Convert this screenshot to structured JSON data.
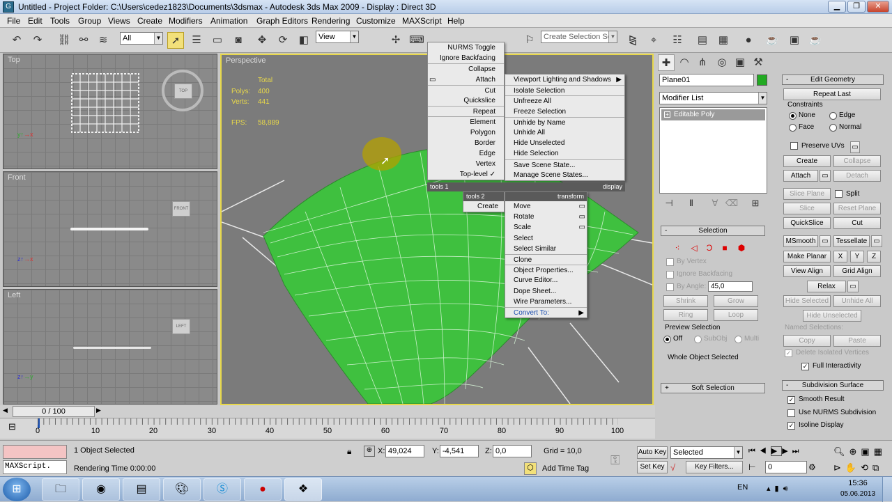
{
  "window": {
    "title": "Untitled     - Project Folder: C:\\Users\\cedez1823\\Documents\\3dsmax     - Autodesk 3ds Max 2009     - Display : Direct 3D",
    "icon": "3dsmax-app-icon"
  },
  "menu": [
    "File",
    "Edit",
    "Tools",
    "Group",
    "Views",
    "Create",
    "Modifiers",
    "Animation",
    "Graph Editors",
    "Rendering",
    "Customize",
    "MAXScript",
    "Help"
  ],
  "toolbar": {
    "selection_filter": "All",
    "reference_coord": "View",
    "named_selection_placeholder": "Create Selection Set",
    "snap_labels": [
      "3",
      "∆",
      "%"
    ]
  },
  "viewports": {
    "top": {
      "label": "Top",
      "cube": "TOP"
    },
    "front": {
      "label": "Front",
      "cube": "FRONT"
    },
    "left": {
      "label": "Left",
      "cube": "LEFT"
    },
    "perspective": {
      "label": "Perspective",
      "stats_header": "Total",
      "polys_label": "Polys:",
      "polys_value": "400",
      "verts_label": "Verts:",
      "verts_value": "441",
      "fps_label": "FPS:",
      "fps_value": "58,889"
    }
  },
  "quad_menu": {
    "tools1": {
      "items": [
        "NURMS Toggle",
        "Ignore Backfacing",
        "Collapse",
        "Attach",
        "Cut",
        "Quickslice",
        "Repeat",
        "Element",
        "Polygon",
        "Border",
        "Edge",
        "Vertex",
        "Top-level"
      ],
      "checked": "Top-level",
      "header_left": "tools 1",
      "header_right": "display"
    },
    "tools2": {
      "header": "tools 2",
      "items": [
        "Create"
      ]
    },
    "display": {
      "items": [
        "Viewport Lighting and Shadows",
        "Isolate Selection",
        "Unfreeze All",
        "Freeze Selection",
        "Unhide by Name",
        "Unhide All",
        "Hide Unselected",
        "Hide Selection",
        "Save Scene State...",
        "Manage Scene States..."
      ]
    },
    "transform": {
      "header": "transform",
      "items": [
        "Move",
        "Rotate",
        "Scale",
        "Select",
        "Select Similar",
        "Clone",
        "Object Properties...",
        "Curve Editor...",
        "Dope Sheet...",
        "Wire Parameters...",
        "Convert To:"
      ]
    }
  },
  "command_panel": {
    "object_name": "Plane01",
    "object_color": "#22aa22",
    "modifier_list": "Modifier List",
    "stack_item": "Editable Poly",
    "selection": {
      "header": "Selection",
      "by_vertex": "By Vertex",
      "ignore_backfacing": "Ignore Backfacing",
      "by_angle": "By Angle:",
      "angle_value": "45,0",
      "shrink": "Shrink",
      "grow": "Grow",
      "ring": "Ring",
      "loop": "Loop",
      "preview_header": "Preview Selection",
      "preview_off": "Off",
      "preview_subobj": "SubObj",
      "preview_multi": "Multi",
      "whole_object": "Whole Object Selected"
    },
    "soft_selection": "Soft Selection",
    "edit_geometry": {
      "header": "Edit Geometry",
      "repeat_last": "Repeat Last",
      "constraints": "Constraints",
      "none": "None",
      "edge": "Edge",
      "face": "Face",
      "normal": "Normal",
      "preserve_uvs": "Preserve UVs",
      "create": "Create",
      "collapse": "Collapse",
      "attach": "Attach",
      "detach": "Detach",
      "slice_plane": "Slice Plane",
      "split": "Split",
      "slice": "Slice",
      "reset_plane": "Reset Plane",
      "quickslice": "QuickSlice",
      "cut": "Cut",
      "msmooth": "MSmooth",
      "tessellate": "Tessellate",
      "make_planar": "Make Planar",
      "x": "X",
      "y": "Y",
      "z": "Z",
      "view_align": "View Align",
      "grid_align": "Grid Align",
      "relax": "Relax",
      "hide_selected": "Hide Selected",
      "unhide_all": "Unhide All",
      "hide_unselected": "Hide Unselected",
      "named_selections": "Named Selections:",
      "copy": "Copy",
      "paste": "Paste",
      "delete_isolated": "Delete Isolated Vertices",
      "full_interactivity": "Full Interactivity"
    },
    "subdivision": {
      "header": "Subdivision Surface",
      "smooth_result": "Smooth Result",
      "use_nurms": "Use NURMS Subdivision",
      "isoline": "Isoline Display"
    }
  },
  "timeline": {
    "frame_display": "0 / 100",
    "ticks": [
      "0",
      "10",
      "20",
      "30",
      "40",
      "50",
      "60",
      "70",
      "80",
      "90",
      "100"
    ]
  },
  "status": {
    "listener": "MAXScript.",
    "selected": "1 Object Selected",
    "rendering_time": "Rendering Time  0:00:00",
    "x_label": "X:",
    "x_value": "49,024",
    "y_label": "Y:",
    "y_value": "-4,541",
    "z_label": "Z:",
    "z_value": "0,0",
    "grid": "Grid = 10,0",
    "add_time_tag": "Add Time Tag",
    "auto_key": "Auto Key",
    "set_key": "Set Key",
    "selected_mode": "Selected",
    "key_filters": "Key Filters...",
    "frame": "0"
  },
  "taskbar": {
    "lang": "EN",
    "time": "15:36",
    "date": "05.06.2013"
  }
}
